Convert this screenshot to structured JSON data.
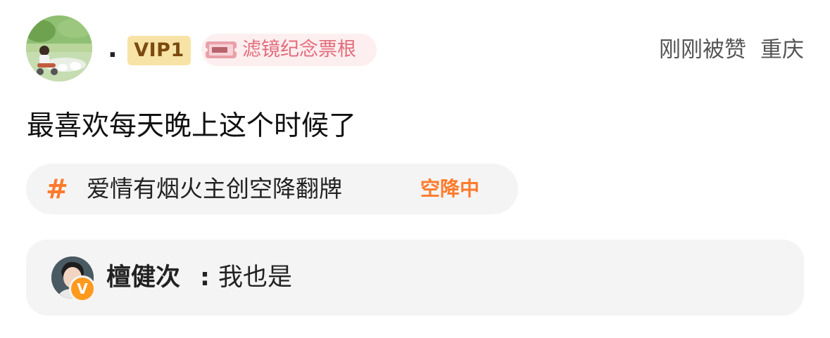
{
  "post": {
    "author": {
      "avatar_icon": "user-avatar-landscape",
      "username": ".",
      "vip_badge": "VIP1",
      "memorial_badge": {
        "icon": "ticket-icon",
        "label": "滤镜纪念票根"
      }
    },
    "meta": {
      "time": "刚刚被赞",
      "location": "重庆"
    },
    "content": "最喜欢每天晚上这个时候了",
    "topic": {
      "hash_symbol": "#",
      "name": "爱情有烟火主创空降翻牌",
      "status": "空降中",
      "accent_color": "#ff7a2b"
    },
    "reply": {
      "avatar_icon": "verified-user-avatar",
      "verify_icon": "verified-v-icon",
      "verify_symbol": "V",
      "author": "檀健次",
      "separator": ":",
      "text": "我也是"
    }
  }
}
